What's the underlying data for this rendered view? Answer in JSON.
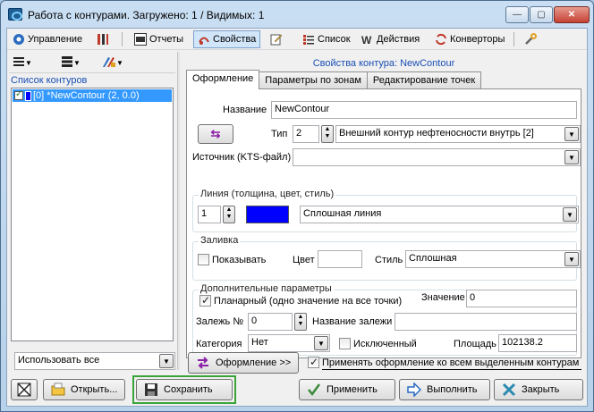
{
  "window": {
    "title": "Работа с контурами. Загружено: 1 / Видимых: 1",
    "min_symbol": "—",
    "max_symbol": "▢",
    "close_symbol": "✕"
  },
  "menu": [
    {
      "label": "Управление",
      "icon": "control-icon"
    },
    {
      "label": "",
      "icon": "ruler-icon"
    },
    {
      "label": "Отчеты",
      "icon": "report-icon"
    },
    {
      "label": "Свойства",
      "icon": "properties-icon",
      "active": true
    },
    {
      "label": "",
      "icon": "edit-icon"
    },
    {
      "label": "Список",
      "icon": "list-icon"
    },
    {
      "label": "Действия",
      "icon": "actions-icon"
    },
    {
      "label": "Конверторы",
      "icon": "converters-icon"
    },
    {
      "label": "",
      "icon": "tools-icon"
    }
  ],
  "left": {
    "list_label": "Список контуров",
    "items": [
      {
        "label": "[0] *NewContour (2, 0.0)",
        "color": "#0000ff",
        "checked": true,
        "selected": true
      }
    ],
    "use_select": "Использовать все"
  },
  "props": {
    "title": "Свойства контура: NewContour",
    "tabs": [
      "Оформление",
      "Параметры по зонам",
      "Редактирование точек"
    ],
    "active_tab": "Оформление",
    "name_label": "Название",
    "name_value": "NewContour",
    "type_label": "Тип",
    "type_num": "2",
    "type_value": "Внешний контур нефтеносности внутрь [2]",
    "source_label": "Источник (KTS-файл)",
    "source_value": "",
    "line_group": "Линия (толщина, цвет, стиль)",
    "line_width": "1",
    "line_color": "#0000ff",
    "line_style": "Сплошная линия",
    "fill_group": "Заливка",
    "fill_show_label": "Показывать",
    "fill_color_label": "Цвет",
    "fill_style_label": "Стиль",
    "fill_style": "Сплошная",
    "extra_group": "Дополнительные параметры",
    "planar_label": "Планарный (одно значение на все точки)",
    "value_label": "Значение",
    "value_value": "0",
    "deposit_label": "Залежь №",
    "deposit_value": "0",
    "deposit_name_label": "Название залежи",
    "deposit_name_value": "",
    "category_label": "Категория",
    "category_value": "Нет",
    "excluded_label": "Исключенный",
    "area_label": "Площадь",
    "area_value": "102138.2",
    "design_button": "Оформление >>",
    "apply_all_label": "Применять оформление ко всем выделенным контурам"
  },
  "buttons": {
    "open": "Открыть...",
    "save": "Сохранить",
    "apply": "Применить",
    "execute": "Выполнить",
    "close": "Закрыть"
  },
  "colors": {
    "accent_blue": "#1a4fb5",
    "selection": "#3399ff",
    "save_highlight": "#3aa43a"
  }
}
